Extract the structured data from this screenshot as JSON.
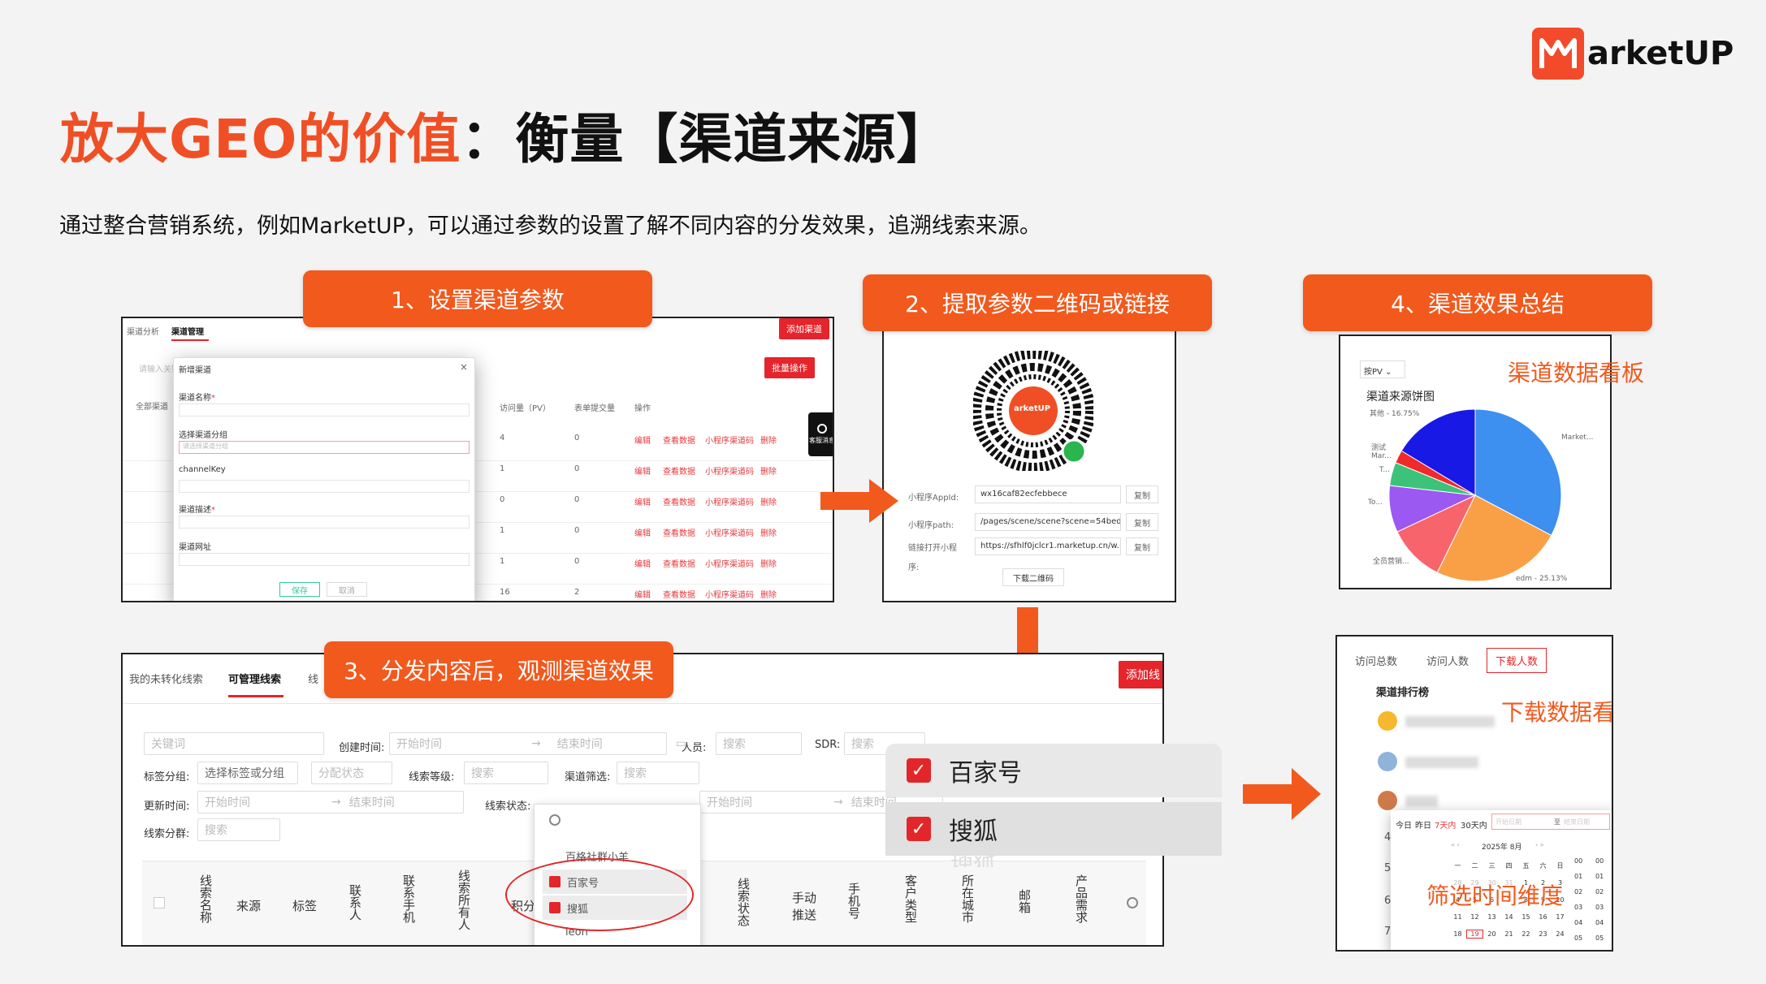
{
  "brand": {
    "logo_text": "arketUP",
    "accent": "#f04f25"
  },
  "title": {
    "highlight": "放大GEO的价值",
    "rest": "：衡量【渠道来源】"
  },
  "subtitle": "通过整合营销系统，例如MarketUP，可以通过参数的设置了解不同内容的分发效果，追溯线索来源。",
  "steps": {
    "s1": "1、设置渠道参数",
    "s2": "2、提取参数二维码或链接",
    "s3": "3、分发内容后，观测渠道效果",
    "s4": "4、渠道效果总结"
  },
  "panel1": {
    "tab_a": "渠道分析",
    "tab_b": "渠道管理",
    "add": "添加渠道",
    "batch": "批量操作",
    "search_placeholder": "请输入关键词",
    "all": "全部渠道",
    "cols": [
      "访问量（PV）",
      "表单提交量",
      "操作"
    ],
    "rows": [
      {
        "pv": "4",
        "sub": "0"
      },
      {
        "pv": "1",
        "sub": "0"
      },
      {
        "pv": "0",
        "sub": "0"
      },
      {
        "pv": "1",
        "sub": "0"
      },
      {
        "pv": "1",
        "sub": "0"
      },
      {
        "pv": "16",
        "sub": "2"
      }
    ],
    "actions": [
      "编辑",
      "查看数据",
      "小程序渠道码",
      "删除"
    ],
    "service": "客服消息",
    "dialog": {
      "title": "新增渠道",
      "name": "渠道名称",
      "group": "选择渠道分组",
      "group_ph": "请选择渠道分组",
      "key": "channelKey",
      "desc": "渠道描述",
      "url": "渠道网址",
      "save": "保存",
      "cancel": "取消"
    }
  },
  "panel2": {
    "qr_label": "arketUP",
    "rows": [
      {
        "label": "小程序AppId:",
        "value": "wx16caf82ecfebbece",
        "copy": "复制"
      },
      {
        "label": "小程序path:",
        "value": "/pages/scene/scene?scene=54bed...",
        "copy": "复制"
      },
      {
        "label": "链接打开小程",
        "value": "https://sfhlf0jclcr1.marketup.cn/w...",
        "copy": "复制"
      }
    ],
    "label_tail": "序:",
    "download": "下载二维码"
  },
  "panel3": {
    "tabs": [
      "我的未转化线索",
      "可管理线索",
      "线"
    ],
    "add": "添加线",
    "f": {
      "kw": "关键词",
      "created": "创建时间:",
      "start": "开始时间",
      "end": "结束时间",
      "person": "人员:",
      "search": "搜索",
      "sdr": "SDR:",
      "tag_group": "标签分组:",
      "tag_ph": "选择标签或分组",
      "assign": "分配状态",
      "level": "线索等级:",
      "channel": "渠道筛选:",
      "updated": "更新时间:",
      "status": "线索状态:",
      "score": "线索分群:"
    },
    "cols": [
      "线索名称",
      "来源",
      "标签",
      "联系人",
      "联系手机",
      "线索所有人",
      "积分",
      "线索状态",
      "手动推送",
      "手机号",
      "客户类型",
      "所在城市",
      "邮箱",
      "产品需求"
    ],
    "dropdown": [
      "百格社群小羊",
      "百家号",
      "搜狐",
      "leon"
    ]
  },
  "zoom": {
    "items": [
      "百家号",
      "搜狐"
    ],
    "ghost": "搜狐"
  },
  "panel4": {
    "select": "按PV",
    "chart_title": "渠道来源饼图",
    "note": "渠道数据看板",
    "labels": {
      "l1": "其他 - 16.75%",
      "l2": "Market...",
      "l3": "测试 Mar...",
      "l4": "T...",
      "l5": "To...",
      "l6": "全员营销...",
      "l7": "edm - 25.13%"
    }
  },
  "chart_data": {
    "type": "pie",
    "title": "渠道来源饼图",
    "labels": [
      "Market...",
      "edm",
      "全员营销...",
      "To...",
      "T...",
      "测试 Mar...",
      "其他"
    ],
    "values": [
      33.5,
      25.13,
      11,
      9,
      4.5,
      2.5,
      16.75
    ],
    "colors": [
      "#3d8ff0",
      "#f9a047",
      "#f7646b",
      "#9b59f1",
      "#3dc27a",
      "#f02a2a",
      "#1919e6"
    ]
  },
  "panel5": {
    "tabs": [
      "访问总数",
      "访问人数",
      "下载人数"
    ],
    "rank_title": "渠道排行榜",
    "note": "下载数据看板",
    "filter_note": "筛选时间维度",
    "ranks": [
      "1",
      "2",
      "3",
      "4",
      "5",
      "6",
      "7"
    ],
    "cal": {
      "quick": [
        "今日",
        "昨日",
        "7天内",
        "30天内"
      ],
      "start": "开始日期",
      "to": "至",
      "end": "结束日期",
      "month": "2025年 8月",
      "nav_l": "« ‹",
      "nav_r": "› »",
      "week": [
        "一",
        "二",
        "三",
        "四",
        "五",
        "六",
        "日"
      ],
      "r1": [
        "28",
        "29",
        "30",
        "31",
        "1",
        "2",
        "3"
      ],
      "r2": [
        "4",
        "5",
        "6",
        "7",
        "8",
        "9",
        "10"
      ],
      "r3": [
        "11",
        "12",
        "13",
        "14",
        "15",
        "16",
        "17"
      ],
      "r4": [
        "18",
        "19",
        "20",
        "21",
        "22",
        "23",
        "24"
      ],
      "h": [
        "00",
        "01",
        "02",
        "03",
        "04",
        "05"
      ]
    }
  }
}
